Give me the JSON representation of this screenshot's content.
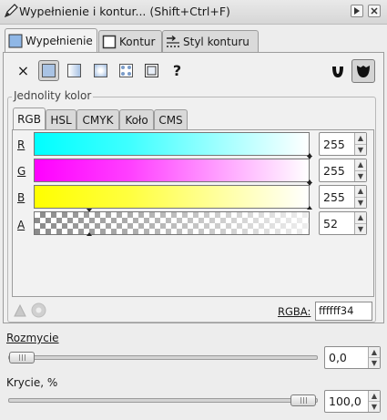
{
  "window": {
    "title": "Wypełnienie i kontur... (Shift+Ctrl+F)"
  },
  "main_tabs": [
    {
      "label": "Wypełnienie",
      "icon": "fill-icon",
      "active": true
    },
    {
      "label": "Kontur",
      "icon": "stroke-paint-icon",
      "active": false
    },
    {
      "label": "Styl konturu",
      "icon": "stroke-style-icon",
      "active": false
    }
  ],
  "fill_types": [
    {
      "name": "no-paint",
      "symbol": "×"
    },
    {
      "name": "flat-color",
      "selected": true
    },
    {
      "name": "linear-gradient"
    },
    {
      "name": "radial-gradient"
    },
    {
      "name": "pattern"
    },
    {
      "name": "swatch"
    },
    {
      "name": "unset",
      "symbol": "?"
    }
  ],
  "fill_rule_icons": [
    "evenodd-fill-icon",
    "nonzero-fill-icon"
  ],
  "solid_color": {
    "frame_label": "Jednolity kolor",
    "tabs": [
      "RGB",
      "HSL",
      "CMYK",
      "Koło",
      "CMS"
    ],
    "active_tab": "RGB",
    "channels": [
      {
        "label": "R",
        "value": "255",
        "color": "#00ffff"
      },
      {
        "label": "G",
        "value": "255",
        "color": "#ff00ff"
      },
      {
        "label": "B",
        "value": "255",
        "color": "#ffff00"
      },
      {
        "label": "A",
        "value": "52",
        "color": "#ffffff"
      }
    ],
    "rgba_label": "RGBA:",
    "rgba_value": "ffffff34"
  },
  "blur": {
    "label": "Rozmycie",
    "value": "0,0",
    "level": 0.0
  },
  "opacity": {
    "label": "Krycie, %",
    "value": "100,0",
    "level": 1.0
  }
}
